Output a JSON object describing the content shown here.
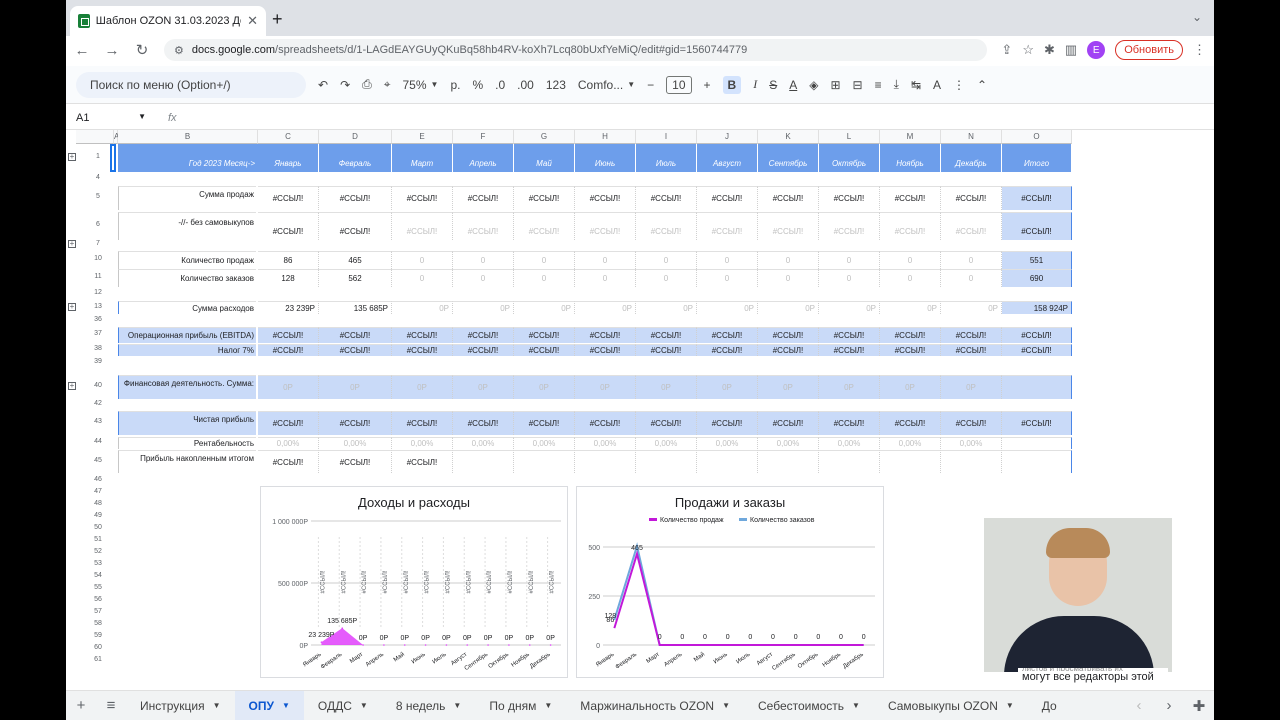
{
  "browser": {
    "tab_title": "Шаблон OZON 31.03.2023 Де",
    "url_host": "docs.google.com",
    "url_path": "/spreadsheets/d/1-LAGdEAYGUyQKuBq58hb4RV-koXh7Lcq80bUxfYeMiQ/edit#gid=1560744779",
    "avatar_letter": "E",
    "update_label": "Обновить"
  },
  "toolbar": {
    "menu_search": "Поиск по меню (Option+/)",
    "zoom": "75%",
    "currency": "р.",
    "percent": "%",
    "dec_minus": ".0",
    "dec_plus": ".00",
    "format_123": "123",
    "font": "Comfo...",
    "font_size": "10",
    "bold": "B",
    "italic": "I"
  },
  "formula_bar": {
    "cell_ref": "A1",
    "fx": "fx"
  },
  "columns": {
    "letters": [
      "A",
      "B",
      "C",
      "D",
      "E",
      "F",
      "G",
      "H",
      "I",
      "J",
      "K",
      "L",
      "M",
      "N",
      "O"
    ],
    "year_label": "Год 2023 Месяц->",
    "months": [
      "Январь",
      "Февраль",
      "Март",
      "Апрель",
      "Май",
      "Июнь",
      "Июль",
      "Август",
      "Сентябрь",
      "Октябрь",
      "Ноябрь",
      "Декабрь",
      "Итого"
    ]
  },
  "rows": [
    {
      "num": "1",
      "plus": true,
      "kind": "header"
    },
    {
      "num": "4",
      "kind": "spacer"
    },
    {
      "num": "5",
      "label": "Сумма продаж",
      "kind": "ref",
      "values": [
        "#ССЫЛ!",
        "#ССЫЛ!",
        "#ССЫЛ!",
        "#ССЫЛ!",
        "#ССЫЛ!",
        "#ССЫЛ!",
        "#ССЫЛ!",
        "#ССЫЛ!",
        "#ССЫЛ!",
        "#ССЫЛ!",
        "#ССЫЛ!",
        "#ССЫЛ!",
        "#ССЫЛ!"
      ]
    },
    {
      "num": "6",
      "label": "-//- без самовыкупов",
      "kind": "ref2",
      "values": [
        "#ССЫЛ!",
        "#ССЫЛ!",
        "#ССЫЛ!",
        "#ССЫЛ!",
        "#ССЫЛ!",
        "#ССЫЛ!",
        "#ССЫЛ!",
        "#ССЫЛ!",
        "#ССЫЛ!",
        "#ССЫЛ!",
        "#ССЫЛ!",
        "#ССЫЛ!",
        "#ССЫЛ!"
      ]
    },
    {
      "num": "7",
      "plus": true,
      "kind": "spacer"
    },
    {
      "num": "10",
      "label": "Количество продаж",
      "kind": "num",
      "values": [
        "86",
        "465",
        "0",
        "0",
        "0",
        "0",
        "0",
        "0",
        "0",
        "0",
        "0",
        "0",
        "551"
      ]
    },
    {
      "num": "11",
      "label": "Количество заказов",
      "kind": "num",
      "values": [
        "128",
        "562",
        "0",
        "0",
        "0",
        "0",
        "0",
        "0",
        "0",
        "0",
        "0",
        "0",
        "690"
      ]
    },
    {
      "num": "12",
      "kind": "spacer"
    },
    {
      "num": "13",
      "plus": true,
      "label": "Сумма расходов",
      "kind": "money",
      "values": [
        "23 239Р",
        "135 685Р",
        "0Р",
        "0Р",
        "0Р",
        "0Р",
        "0Р",
        "0Р",
        "0Р",
        "0Р",
        "0Р",
        "0Р",
        "158 924Р"
      ]
    },
    {
      "num": "36",
      "kind": "spacer"
    },
    {
      "num": "37",
      "label": "Операционная прибыль (EBITDA)",
      "kind": "blueref",
      "values": [
        "#ССЫЛ!",
        "#ССЫЛ!",
        "#ССЫЛ!",
        "#ССЫЛ!",
        "#ССЫЛ!",
        "#ССЫЛ!",
        "#ССЫЛ!",
        "#ССЫЛ!",
        "#ССЫЛ!",
        "#ССЫЛ!",
        "#ССЫЛ!",
        "#ССЫЛ!",
        "#ССЫЛ!"
      ]
    },
    {
      "num": "38",
      "label": "Налог 7%",
      "kind": "blueref",
      "values": [
        "#ССЫЛ!",
        "#ССЫЛ!",
        "#ССЫЛ!",
        "#ССЫЛ!",
        "#ССЫЛ!",
        "#ССЫЛ!",
        "#ССЫЛ!",
        "#ССЫЛ!",
        "#ССЫЛ!",
        "#ССЫЛ!",
        "#ССЫЛ!",
        "#ССЫЛ!",
        "#ССЫЛ!"
      ]
    },
    {
      "num": "39",
      "kind": "spacer"
    },
    {
      "num": "40",
      "plus": true,
      "label": "Финансовая деятельность. Сумма:",
      "kind": "bluefaint",
      "values": [
        "0Р",
        "0Р",
        "0Р",
        "0Р",
        "0Р",
        "0Р",
        "0Р",
        "0Р",
        "0Р",
        "0Р",
        "0Р",
        "0Р",
        ""
      ]
    },
    {
      "num": "42",
      "kind": "spacer"
    },
    {
      "num": "43",
      "label": "Чистая прибыль",
      "kind": "blueref",
      "values": [
        "#ССЫЛ!",
        "#ССЫЛ!",
        "#ССЫЛ!",
        "#ССЫЛ!",
        "#ССЫЛ!",
        "#ССЫЛ!",
        "#ССЫЛ!",
        "#ССЫЛ!",
        "#ССЫЛ!",
        "#ССЫЛ!",
        "#ССЫЛ!",
        "#ССЫЛ!",
        "#ССЫЛ!"
      ]
    },
    {
      "num": "44",
      "label": "Рентабельность",
      "kind": "faint",
      "values": [
        "0,00%",
        "0,00%",
        "0,00%",
        "0,00%",
        "0,00%",
        "0,00%",
        "0,00%",
        "0,00%",
        "0,00%",
        "0,00%",
        "0,00%",
        "0,00%",
        ""
      ]
    },
    {
      "num": "45",
      "label": "Прибыль накопленным итогом",
      "kind": "plain",
      "values": [
        "#ССЫЛ!",
        "#ССЫЛ!",
        "#ССЫЛ!",
        "",
        "",
        "",
        "",
        "",
        "",
        "",
        "",
        "",
        ""
      ]
    }
  ],
  "empty_rows": [
    "46",
    "47",
    "48",
    "49",
    "50",
    "51",
    "52",
    "53",
    "54",
    "55",
    "56",
    "57",
    "58",
    "59",
    "60",
    "61"
  ],
  "chart_data": [
    {
      "type": "area",
      "title": "Доходы и расходы",
      "categories": [
        "Январь",
        "Февраль",
        "Март",
        "Апрель",
        "Май",
        "Июнь",
        "Июль",
        "Август",
        "Сентябрь",
        "Октябрь",
        "Ноябрь",
        "Декабрь"
      ],
      "y_ticks": [
        "1 000 000Р",
        "500 000Р",
        "0Р"
      ],
      "ylim": [
        0,
        1000000
      ],
      "series": [
        {
          "values": [
            23239,
            135685,
            0,
            0,
            0,
            0,
            0,
            0,
            0,
            0,
            0,
            0
          ],
          "color": "#e040fb"
        }
      ],
      "data_labels": [
        "23 239Р",
        "135 685Р",
        "0Р",
        "0Р",
        "0Р",
        "0Р",
        "0Р",
        "0Р",
        "0Р",
        "0Р",
        "0Р",
        "0Р"
      ],
      "error_labels": [
        "#ССЫЛ!",
        "#ССЫЛ!",
        "#ССЫЛ!",
        "#ССЫЛ!",
        "#ССЫЛ!",
        "#ССЫЛ!",
        "#ССЫЛ!",
        "#ССЫЛ!",
        "#ССЫЛ!",
        "#ССЫЛ!",
        "#ССЫЛ!",
        "#ССЫЛ!"
      ]
    },
    {
      "type": "line",
      "title": "Продажи и заказы",
      "categories": [
        "Январь",
        "Февраль",
        "Март",
        "Апрель",
        "Май",
        "Июнь",
        "Июль",
        "Август",
        "Сентябрь",
        "Октябрь",
        "Ноябрь",
        "Декабрь"
      ],
      "y_ticks": [
        "500",
        "250",
        "0"
      ],
      "ylim": [
        0,
        500
      ],
      "legend": "top",
      "series": [
        {
          "name": "Количество продаж",
          "values": [
            86,
            465,
            0,
            0,
            0,
            0,
            0,
            0,
            0,
            0,
            0,
            0
          ],
          "color": "#c218d9"
        },
        {
          "name": "Количество заказов",
          "values": [
            128,
            562,
            0,
            0,
            0,
            0,
            0,
            0,
            0,
            0,
            0,
            0
          ],
          "color": "#6fa8dc"
        }
      ],
      "data_labels": [
        "86",
        "465",
        "0",
        "0",
        "0",
        "0",
        "0",
        "0",
        "0",
        "0",
        "0",
        "0"
      ],
      "orders_label_jan": "128"
    }
  ],
  "sheet_tabs": [
    "Инструкция",
    "ОПУ",
    "ОДДС",
    "8 недель",
    "По дням",
    "Маржинальность OZON",
    "Себестоимость",
    "Самовыкупы OZON",
    "До"
  ],
  "active_sheet": "ОПУ",
  "overlay_text": "могут все редакторы этой",
  "overlay_text_partial": "листов и просматривать их"
}
